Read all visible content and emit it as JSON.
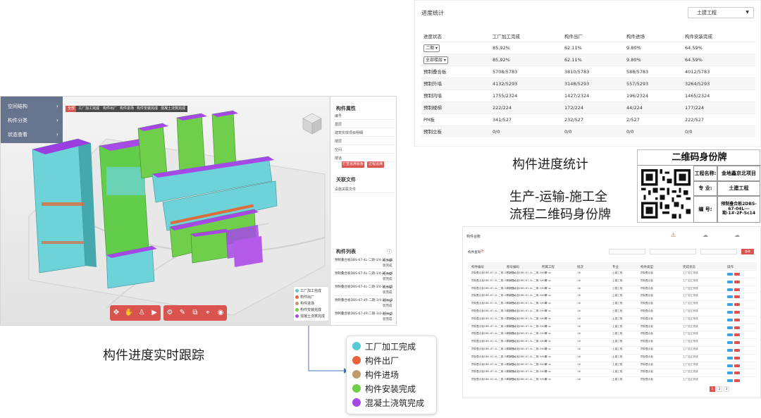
{
  "bim": {
    "left_menu": [
      {
        "label": "空间结构"
      },
      {
        "label": "构件分类"
      },
      {
        "label": "状态查看"
      }
    ],
    "top_tags": [
      "全部",
      "工厂加工完成",
      "构件出厂",
      "构件进场",
      "构件安装完成",
      "混凝土浇筑完成"
    ],
    "toolbar_icons": [
      "navigate-icon",
      "hand-icon",
      "person-icon",
      "camera-icon",
      "settings-icon",
      "measure-icon",
      "section-icon",
      "location-icon",
      "eye-icon"
    ],
    "legend": [
      {
        "label": "工厂加工完成",
        "color": "#5bc8d8"
      },
      {
        "label": "构件出厂",
        "color": "#e8643c"
      },
      {
        "label": "构件进场",
        "color": "#c09a6b"
      },
      {
        "label": "构件安装完成",
        "color": "#6fce4a"
      },
      {
        "label": "混凝土浇筑完成",
        "color": "#a648e6"
      }
    ],
    "attr_panel": {
      "title": "构件属性",
      "rows": [
        "编号",
        "基层",
        "建筑实体项目明细",
        "楼层",
        "空间",
        "楼道"
      ],
      "btn_track": "打签追溯看板",
      "btn_reissue": "过程追溯"
    },
    "files_panel": {
      "title": "关联文件",
      "rows": [
        "设施关联文件"
      ]
    },
    "component_list": {
      "title": "构件列表",
      "items": [
        {
          "name": "预制叠合板DBS-67-4L-二期-3/4-2F-sd6",
          "status": "构件安装完成"
        },
        {
          "name": "预制叠合板DBS-67-4L-二期-3/4-2F-sd4",
          "status": "构件安装完成"
        },
        {
          "name": "预制叠合板DBS-67-4L-二期-3/4-2F-sd3",
          "status": "构件安装完成"
        },
        {
          "name": "预制叠合板DBS-67-4R-二期-3/4-2F-sc3",
          "status": "构件安装完成"
        },
        {
          "name": "预制叠合板DBS-67-4R-二期-3/4-2F-sc1",
          "status": "构件安装完成"
        }
      ]
    }
  },
  "progress": {
    "title": "进度统计",
    "filter_value": "土建工程",
    "headers": [
      "进度状态",
      "工厂加工完成",
      "构件出厂",
      "构件进场",
      "构件安装完成"
    ],
    "select_rows": [
      {
        "select": "二期",
        "values": [
          "85.92%",
          "62.11%",
          "9.80%",
          "64.59%"
        ]
      },
      {
        "select": "全部楼层",
        "values": [
          "85.92%",
          "62.11%",
          "9.80%",
          "64.59%"
        ]
      }
    ],
    "rows": [
      {
        "label": "预制叠合板",
        "values": [
          "5708/5783",
          "3810/5783",
          "588/5783",
          "4012/5783"
        ]
      },
      {
        "label": "预制外墙",
        "values": [
          "4132/5293",
          "3148/5293",
          "557/5293",
          "3264/5293"
        ]
      },
      {
        "label": "预制内墙",
        "values": [
          "1755/2324",
          "1427/2324",
          "196/2324",
          "1465/2324"
        ]
      },
      {
        "label": "预制楼梯",
        "values": [
          "222/224",
          "172/224",
          "44/224",
          "177/224"
        ]
      },
      {
        "label": "PM板",
        "values": [
          "341/527",
          "232/527",
          "2/527",
          "222/527"
        ]
      },
      {
        "label": "预制立板",
        "values": [
          "0/0",
          "0/0",
          "0/0",
          "0/0"
        ]
      }
    ]
  },
  "captions": {
    "progress_stats": "构件进度统计",
    "qr_line1": "生产-运输-施工全",
    "qr_line2": "流程二维码身份牌",
    "realtime": "构件进度实时跟踪"
  },
  "qr_card": {
    "title": "二维码身份牌",
    "project_label": "工程名称:",
    "project_value": "金地鑫京北项目",
    "major_label": "专    业:",
    "major_value": "土建工程",
    "code_label": "编    号:",
    "code_value": "预制叠合板2DBS-67-04L---期-1#-2F-Sc14"
  },
  "list_page": {
    "title": "构件台账",
    "search_label": "构件查询",
    "search_btn": "查询",
    "headers": [
      "构件编号",
      "图号编码",
      "所属工程",
      "批次",
      "专业",
      "构件类型",
      "完成状态",
      "操作"
    ],
    "row_name": "预制叠合板DBS-67-4L-二期-3/4-2F-sc",
    "row_project": "一期",
    "row_batch": "1#",
    "row_major": "土建工程",
    "row_type": "预制叠合板",
    "row_status": "工厂加工完成",
    "pagination": [
      "1",
      "2",
      "3"
    ]
  }
}
